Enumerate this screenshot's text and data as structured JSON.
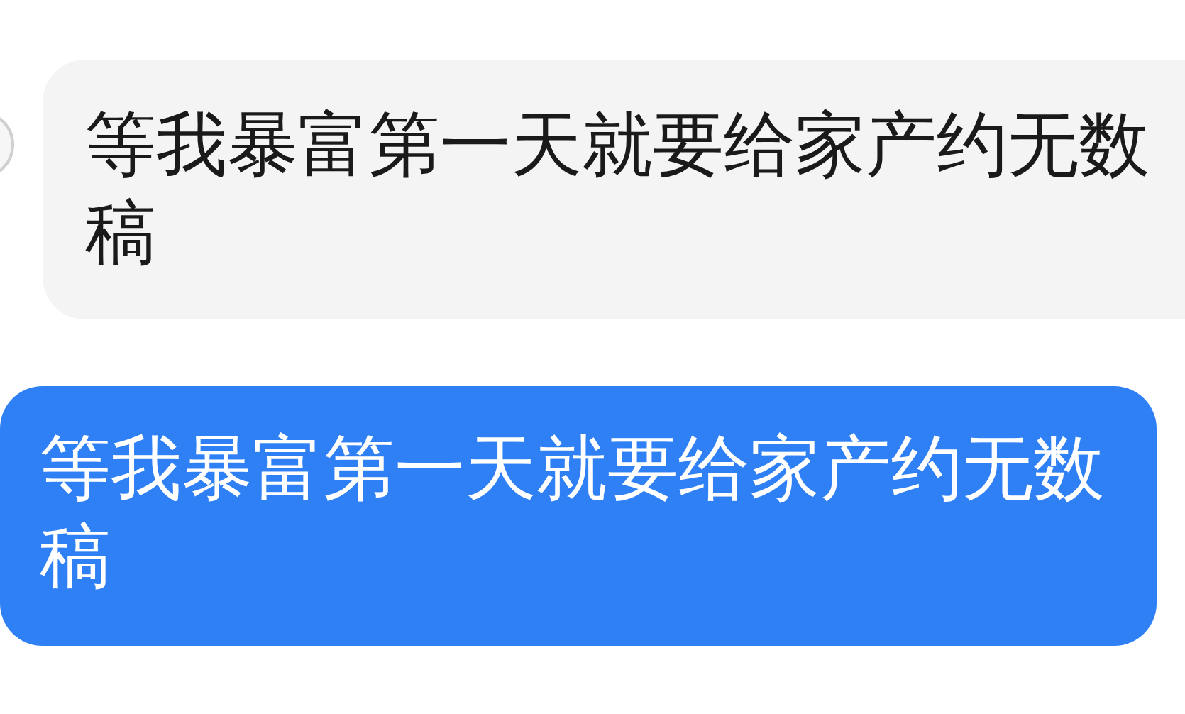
{
  "messages": [
    {
      "kind": "received",
      "text": "等我暴富第一天就要给家产约无数稿"
    },
    {
      "kind": "sent",
      "text": "等我暴富第一天就要给家产约无数稿"
    }
  ]
}
